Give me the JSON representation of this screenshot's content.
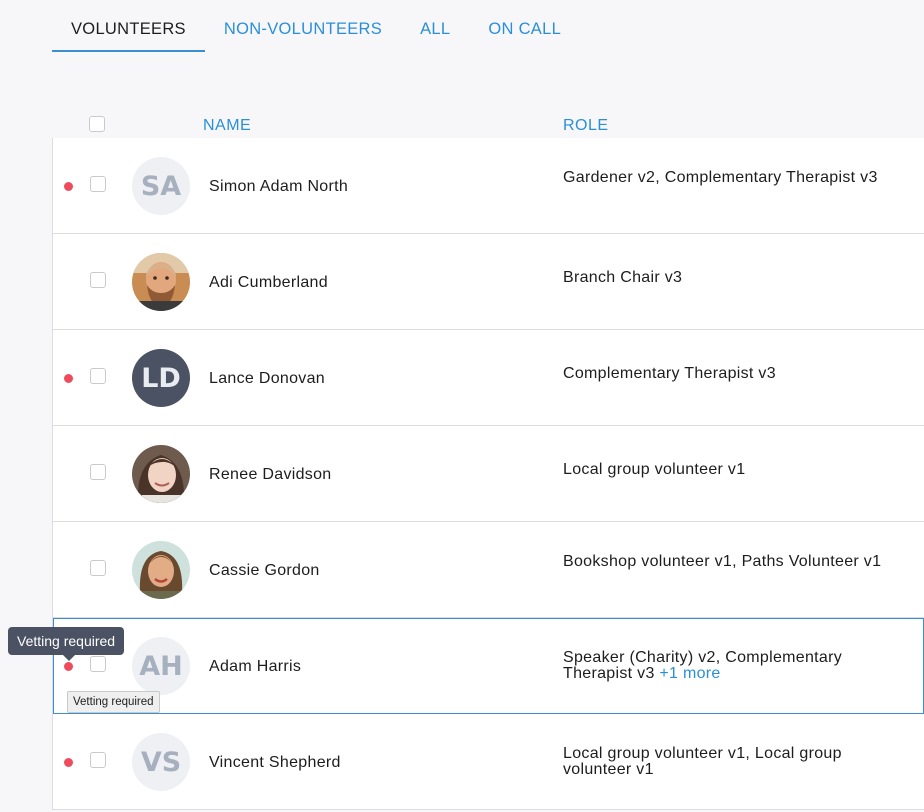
{
  "tabs": [
    {
      "label": "VOLUNTEERS",
      "active": true
    },
    {
      "label": "NON-VOLUNTEERS",
      "active": false
    },
    {
      "label": "ALL",
      "active": false
    },
    {
      "label": "ON CALL",
      "active": false
    }
  ],
  "table": {
    "headers": {
      "name": "NAME",
      "role": "ROLE"
    },
    "rows": [
      {
        "name": "Simon Adam North",
        "initials": "SA",
        "avatar": "initials-light",
        "role": "Gardener v2, Complementary Therapist v3",
        "alert": true
      },
      {
        "name": "Adi Cumberland",
        "avatar": "photo",
        "role": "Branch Chair v3",
        "alert": false
      },
      {
        "name": "Lance Donovan",
        "initials": "LD",
        "avatar": "initials-dark",
        "role": "Complementary Therapist v3",
        "alert": true
      },
      {
        "name": "Renee Davidson",
        "avatar": "photo",
        "role": "Local group volunteer v1",
        "alert": false
      },
      {
        "name": "Cassie Gordon",
        "avatar": "photo",
        "role": "Bookshop volunteer v1, Paths Volunteer v1",
        "alert": false
      },
      {
        "name": "Adam Harris",
        "initials": "AH",
        "avatar": "initials-light",
        "role": "Speaker (Charity) v2, Complementary Therapist v3",
        "more": "+1 more",
        "alert": true,
        "selected": true
      },
      {
        "name": "Vincent Shepherd",
        "initials": "VS",
        "avatar": "initials-light",
        "role": "Local group volunteer v1, Local group volunteer v1",
        "alert": true
      }
    ]
  },
  "tooltips": {
    "vetting": "Vetting required",
    "vetting_native": "Vetting required"
  },
  "colors": {
    "accent": "#2b8fd8",
    "alert_dot": "#ef4b5c",
    "tooltip_bg": "#4a5263"
  }
}
